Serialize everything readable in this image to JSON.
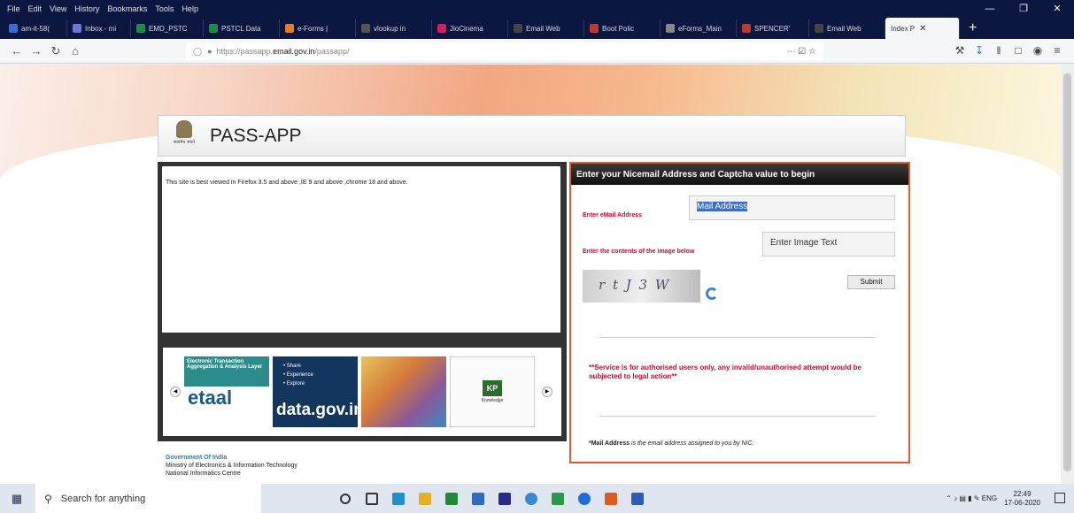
{
  "menubar": {
    "items": [
      "File",
      "Edit",
      "View",
      "History",
      "Bookmarks",
      "Tools",
      "Help"
    ]
  },
  "tabs": [
    {
      "label": "am-it-58(",
      "color": "#3b6cd4"
    },
    {
      "label": "Inbox - mi",
      "color": "#6a7ad4"
    },
    {
      "label": "EMD_PSTC",
      "color": "#1e8a4a"
    },
    {
      "label": "PSTCL Data",
      "color": "#1e8a4a"
    },
    {
      "label": "e-Forms |",
      "color": "#e67e22"
    },
    {
      "label": "vlookup in",
      "color": "#555555"
    },
    {
      "label": "JioCinema",
      "color": "#d81b60"
    },
    {
      "label": "Email Web",
      "color": "#444444"
    },
    {
      "label": "Boot Polic",
      "color": "#c0392b"
    },
    {
      "label": "eForms_Main",
      "color": "#888888"
    },
    {
      "label": "SPENCER'",
      "color": "#c0392b"
    },
    {
      "label": "Email Web",
      "color": "#444444"
    },
    {
      "label": "Index P",
      "color": "#999999",
      "active": true
    }
  ],
  "nav": {
    "url_prefix": "https://passapp.",
    "url_host": "email.gov.in",
    "url_suffix": "/passapp/"
  },
  "page": {
    "title": "PASS-APP",
    "emblem_caption": "सत्यमेव जयते",
    "browser_notice": "This site is best viewed in Firefox 3.5 and above ,IE 9 and above ,chrome 18 and above.",
    "form_heading": "Enter your Nicemail Address and Captcha value to begin",
    "email_label": "Enter eMail Address",
    "email_value": "Mail Address",
    "captcha_label": "Enter the contents of the image below",
    "captcha_placeholder": "Enter Image Text",
    "captcha_text": "r t J 3 W",
    "submit_label": "Submit",
    "warning": "**Service is for authorised users only, any invalid/unauthorised attempt would be subjected to legal action**",
    "note_bold": "*Mail Address",
    "note_rest": " is the email address assigned to you by NIC."
  },
  "carousel": {
    "etaal_band": "Electronic Transaction Aggregation & Analysis Layer",
    "etaal_brand": "etaal",
    "dgov_items": [
      "• Share",
      "• Experience",
      "• Explore"
    ],
    "dgov_brand": "data.gov.in",
    "kp_mark": "KP",
    "kp_caption": "Knowledge"
  },
  "footer": {
    "line1": "Government Of India",
    "line2": "Ministry of Electronics & Information Technology",
    "line3": "National Informatics Centre"
  },
  "taskbar": {
    "search_placeholder": "Search for anything",
    "language": "ENG",
    "time": "22:49",
    "date": "17-06-2020",
    "app_colors": [
      "#555555",
      "#2a6cc8",
      "#1e90d0",
      "#e8b020",
      "#1f8a3a",
      "#2a6cc8",
      "#2a2a8a",
      "#3a8ad4",
      "#2a9a4a",
      "#1f6cd8",
      "#e05a1a",
      "#2a5cb8"
    ]
  }
}
